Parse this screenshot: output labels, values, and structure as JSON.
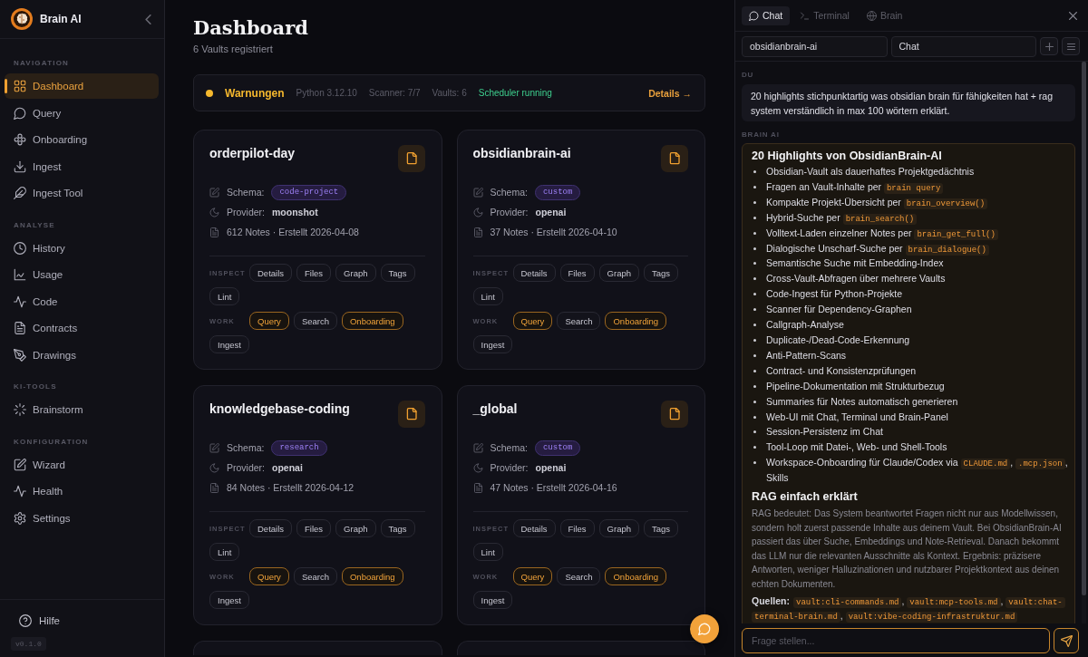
{
  "sidebar": {
    "brand": "Brain AI",
    "sections": [
      {
        "title": "NAVIGATION",
        "items": [
          {
            "label": "Dashboard",
            "selected": true
          },
          {
            "label": "Query",
            "selected": false
          },
          {
            "label": "Onboarding",
            "selected": false
          },
          {
            "label": "Ingest",
            "selected": false
          },
          {
            "label": "Ingest Tool",
            "selected": false
          }
        ]
      },
      {
        "title": "ANALYSE",
        "items": [
          {
            "label": "History",
            "selected": false
          },
          {
            "label": "Usage",
            "selected": false
          },
          {
            "label": "Code",
            "selected": false
          },
          {
            "label": "Contracts",
            "selected": false
          },
          {
            "label": "Drawings",
            "selected": false
          }
        ]
      },
      {
        "title": "KI-TOOLS",
        "items": [
          {
            "label": "Brainstorm",
            "selected": false
          }
        ]
      },
      {
        "title": "KONFIGURATION",
        "items": [
          {
            "label": "Wizard",
            "selected": false
          },
          {
            "label": "Health",
            "selected": false
          },
          {
            "label": "Settings",
            "selected": false
          }
        ]
      }
    ],
    "help": "Hilfe",
    "version": "v0.1.0"
  },
  "header": {
    "title": "Dashboard",
    "subtitle": "6 Vaults registriert"
  },
  "status_bar": {
    "kind": "warning",
    "label": "Warnungen",
    "items": [
      {
        "text": "Python 3.12.10",
        "kind": "info"
      },
      {
        "text": "Scanner: 7/7",
        "kind": "info"
      },
      {
        "text": "Vaults: 6",
        "kind": "info"
      },
      {
        "text": "Scheduler running",
        "kind": "ok"
      }
    ],
    "link": "Details →"
  },
  "vaults": [
    {
      "name": "orderpilot-day",
      "schema_label": "Schema:",
      "schema": "code-project",
      "provider_label": "Provider:",
      "provider": "moonshot",
      "meta": "612 Notes · Erstellt 2026-04-08",
      "groups": [
        {
          "label": "INSPECT",
          "actions": [
            {
              "label": "Details",
              "primary": false
            },
            {
              "label": "Files",
              "primary": false
            },
            {
              "label": "Graph",
              "primary": false
            },
            {
              "label": "Tags",
              "primary": false
            },
            {
              "label": "Lint",
              "primary": false
            }
          ]
        },
        {
          "label": "WORK",
          "actions": [
            {
              "label": "Query",
              "primary": true
            },
            {
              "label": "Search",
              "primary": false
            },
            {
              "label": "Onboarding",
              "primary": true
            },
            {
              "label": "Ingest",
              "primary": false
            }
          ]
        }
      ]
    },
    {
      "name": "obsidianbrain-ai",
      "schema_label": "Schema:",
      "schema": "custom",
      "provider_label": "Provider:",
      "provider": "openai",
      "meta": "37 Notes · Erstellt 2026-04-10",
      "groups": [
        {
          "label": "INSPECT",
          "actions": [
            {
              "label": "Details",
              "primary": false
            },
            {
              "label": "Files",
              "primary": false
            },
            {
              "label": "Graph",
              "primary": false
            },
            {
              "label": "Tags",
              "primary": false
            },
            {
              "label": "Lint",
              "primary": false
            }
          ]
        },
        {
          "label": "WORK",
          "actions": [
            {
              "label": "Query",
              "primary": true
            },
            {
              "label": "Search",
              "primary": false
            },
            {
              "label": "Onboarding",
              "primary": true
            },
            {
              "label": "Ingest",
              "primary": false
            }
          ]
        }
      ]
    },
    {
      "name": "knowledgebase-coding",
      "schema_label": "Schema:",
      "schema": "research",
      "provider_label": "Provider:",
      "provider": "openai",
      "meta": "84 Notes · Erstellt 2026-04-12",
      "groups": [
        {
          "label": "INSPECT",
          "actions": [
            {
              "label": "Details",
              "primary": false
            },
            {
              "label": "Files",
              "primary": false
            },
            {
              "label": "Graph",
              "primary": false
            },
            {
              "label": "Tags",
              "primary": false
            },
            {
              "label": "Lint",
              "primary": false
            }
          ]
        },
        {
          "label": "WORK",
          "actions": [
            {
              "label": "Query",
              "primary": true
            },
            {
              "label": "Search",
              "primary": false
            },
            {
              "label": "Onboarding",
              "primary": true
            },
            {
              "label": "Ingest",
              "primary": false
            }
          ]
        }
      ]
    },
    {
      "name": "_global",
      "schema_label": "Schema:",
      "schema": "custom",
      "provider_label": "Provider:",
      "provider": "openai",
      "meta": "47 Notes · Erstellt 2026-04-16",
      "groups": [
        {
          "label": "INSPECT",
          "actions": [
            {
              "label": "Details",
              "primary": false
            },
            {
              "label": "Files",
              "primary": false
            },
            {
              "label": "Graph",
              "primary": false
            },
            {
              "label": "Tags",
              "primary": false
            },
            {
              "label": "Lint",
              "primary": false
            }
          ]
        },
        {
          "label": "WORK",
          "actions": [
            {
              "label": "Query",
              "primary": true
            },
            {
              "label": "Search",
              "primary": false
            },
            {
              "label": "Onboarding",
              "primary": true
            },
            {
              "label": "Ingest",
              "primary": false
            }
          ]
        }
      ]
    }
  ],
  "chat_panel": {
    "tabs": [
      {
        "label": "Chat",
        "selected": true
      },
      {
        "label": "Terminal",
        "selected": false
      },
      {
        "label": "Brain",
        "selected": false
      }
    ],
    "vault_select": "obsidianbrain-ai",
    "mode_select": "Chat",
    "messages": [
      {
        "kind": "user",
        "author": "DU",
        "text": "20 highlights stichpunktartig was obsidian brain für fähigkeiten hat + rag system verständlich in max 100 wörtern erklärt."
      },
      {
        "kind": "assistant",
        "author": "BRAIN AI",
        "blocks": [
          {
            "kind": "heading",
            "text": "20 Highlights von ObsidianBrain-AI"
          },
          {
            "kind": "list",
            "items": [
              {
                "parts": [
                  {
                    "kind": "text",
                    "text": "Obsidian-Vault als dauerhaftes Projektgedächtnis"
                  }
                ]
              },
              {
                "parts": [
                  {
                    "kind": "text",
                    "text": "Fragen an Vault-Inhalte per "
                  },
                  {
                    "kind": "code",
                    "text": "brain query"
                  }
                ]
              },
              {
                "parts": [
                  {
                    "kind": "text",
                    "text": "Kompakte Projekt-Übersicht per "
                  },
                  {
                    "kind": "code",
                    "text": "brain_overview()"
                  }
                ]
              },
              {
                "parts": [
                  {
                    "kind": "text",
                    "text": "Hybrid-Suche per "
                  },
                  {
                    "kind": "code",
                    "text": "brain_search()"
                  }
                ]
              },
              {
                "parts": [
                  {
                    "kind": "text",
                    "text": "Volltext-Laden einzelner Notes per "
                  },
                  {
                    "kind": "code",
                    "text": "brain_get_full()"
                  }
                ]
              },
              {
                "parts": [
                  {
                    "kind": "text",
                    "text": "Dialogische Unscharf-Suche per "
                  },
                  {
                    "kind": "code",
                    "text": "brain_dialogue()"
                  }
                ]
              },
              {
                "parts": [
                  {
                    "kind": "text",
                    "text": "Semantische Suche mit Embedding-Index"
                  }
                ]
              },
              {
                "parts": [
                  {
                    "kind": "text",
                    "text": "Cross-Vault-Abfragen über mehrere Vaults"
                  }
                ]
              },
              {
                "parts": [
                  {
                    "kind": "text",
                    "text": "Code-Ingest für Python-Projekte"
                  }
                ]
              },
              {
                "parts": [
                  {
                    "kind": "text",
                    "text": "Scanner für Dependency-Graphen"
                  }
                ]
              },
              {
                "parts": [
                  {
                    "kind": "text",
                    "text": "Callgraph-Analyse"
                  }
                ]
              },
              {
                "parts": [
                  {
                    "kind": "text",
                    "text": "Duplicate-/Dead-Code-Erkennung"
                  }
                ]
              },
              {
                "parts": [
                  {
                    "kind": "text",
                    "text": "Anti-Pattern-Scans"
                  }
                ]
              },
              {
                "parts": [
                  {
                    "kind": "text",
                    "text": "Contract- und Konsistenzprüfungen"
                  }
                ]
              },
              {
                "parts": [
                  {
                    "kind": "text",
                    "text": "Pipeline-Dokumentation mit Strukturbezug"
                  }
                ]
              },
              {
                "parts": [
                  {
                    "kind": "text",
                    "text": "Summaries für Notes automatisch generieren"
                  }
                ]
              },
              {
                "parts": [
                  {
                    "kind": "text",
                    "text": "Web-UI mit Chat, Terminal und Brain-Panel"
                  }
                ]
              },
              {
                "parts": [
                  {
                    "kind": "text",
                    "text": "Session-Persistenz im Chat"
                  }
                ]
              },
              {
                "parts": [
                  {
                    "kind": "text",
                    "text": "Tool-Loop mit Datei-, Web- und Shell-Tools"
                  }
                ]
              },
              {
                "parts": [
                  {
                    "kind": "text",
                    "text": "Workspace-Onboarding für Claude/Codex via "
                  },
                  {
                    "kind": "code",
                    "text": "CLAUDE.md"
                  },
                  {
                    "kind": "text",
                    "text": ", "
                  },
                  {
                    "kind": "code",
                    "text": ".mcp.json"
                  },
                  {
                    "kind": "text",
                    "text": ", Skills"
                  }
                ]
              }
            ]
          },
          {
            "kind": "heading",
            "text": "RAG einfach erklärt"
          },
          {
            "kind": "paragraph",
            "text": "RAG bedeutet: Das System beantwortet Fragen nicht nur aus Modellwissen, sondern holt zuerst passende Inhalte aus deinem Vault. Bei ObsidianBrain-AI passiert das über Suche, Embeddings und Note-Retrieval. Danach bekommt das LLM nur die relevanten Ausschnitte als Kontext. Ergebnis: präzisere Antworten, weniger Halluzinationen und nutzbarer Projektkontext aus deinen echten Dokumenten."
          },
          {
            "kind": "sources",
            "parts": [
              {
                "kind": "strong",
                "text": "Quellen:"
              },
              {
                "kind": "code",
                "text": "vault:cli-commands.md"
              },
              {
                "kind": "text",
                "text": ", "
              },
              {
                "kind": "code",
                "text": "vault:mcp-tools.md"
              },
              {
                "kind": "text",
                "text": ", "
              },
              {
                "kind": "code",
                "text": "vault:chat-terminal-brain.md"
              },
              {
                "kind": "text",
                "text": ", "
              },
              {
                "kind": "code",
                "text": "vault:vibe-coding-infrastruktur.md"
              }
            ]
          }
        ]
      }
    ],
    "input": {
      "placeholder": "Frage stellen..."
    }
  }
}
